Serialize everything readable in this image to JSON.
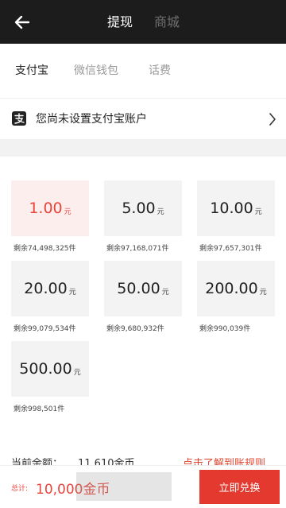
{
  "header": {
    "tabs": [
      {
        "label": "提现",
        "active": true
      },
      {
        "label": "商城",
        "active": false
      }
    ],
    "back_icon": "arrow-left-icon"
  },
  "pay_tabs": [
    {
      "label": "支付宝",
      "active": true
    },
    {
      "label": "微信钱包",
      "active": false
    },
    {
      "label": "话费",
      "active": false
    }
  ],
  "account": {
    "icon": "alipay-icon",
    "text": "您尚未设置支付宝账户",
    "chevron": "chevron-right-icon"
  },
  "options": [
    {
      "amount": "1.00",
      "unit": "元",
      "remain": "剩余74,498,325件",
      "selected": true
    },
    {
      "amount": "5.00",
      "unit": "元",
      "remain": "剩余97,168,071件",
      "selected": false
    },
    {
      "amount": "10.00",
      "unit": "元",
      "remain": "剩余97,657,301件",
      "selected": false
    },
    {
      "amount": "20.00",
      "unit": "元",
      "remain": "剩余99,079,534件",
      "selected": false
    },
    {
      "amount": "50.00",
      "unit": "元",
      "remain": "剩余9,680,932件",
      "selected": false
    },
    {
      "amount": "200.00",
      "unit": "元",
      "remain": "剩余990,039件",
      "selected": false
    },
    {
      "amount": "500.00",
      "unit": "元",
      "remain": "剩余998,501件",
      "selected": false
    }
  ],
  "balance": {
    "label": "当前余额：",
    "value": "11,610金币",
    "rules_link": "点击了解到账规则"
  },
  "footer": {
    "total_label": "总计:",
    "total_value": "10,000金币",
    "button": "立即兑换"
  },
  "colors": {
    "accent": "#e3392e",
    "topbar": "#1c1c1c",
    "card_bg": "#f3f3f3",
    "card_selected_bg": "#fdeeee"
  }
}
